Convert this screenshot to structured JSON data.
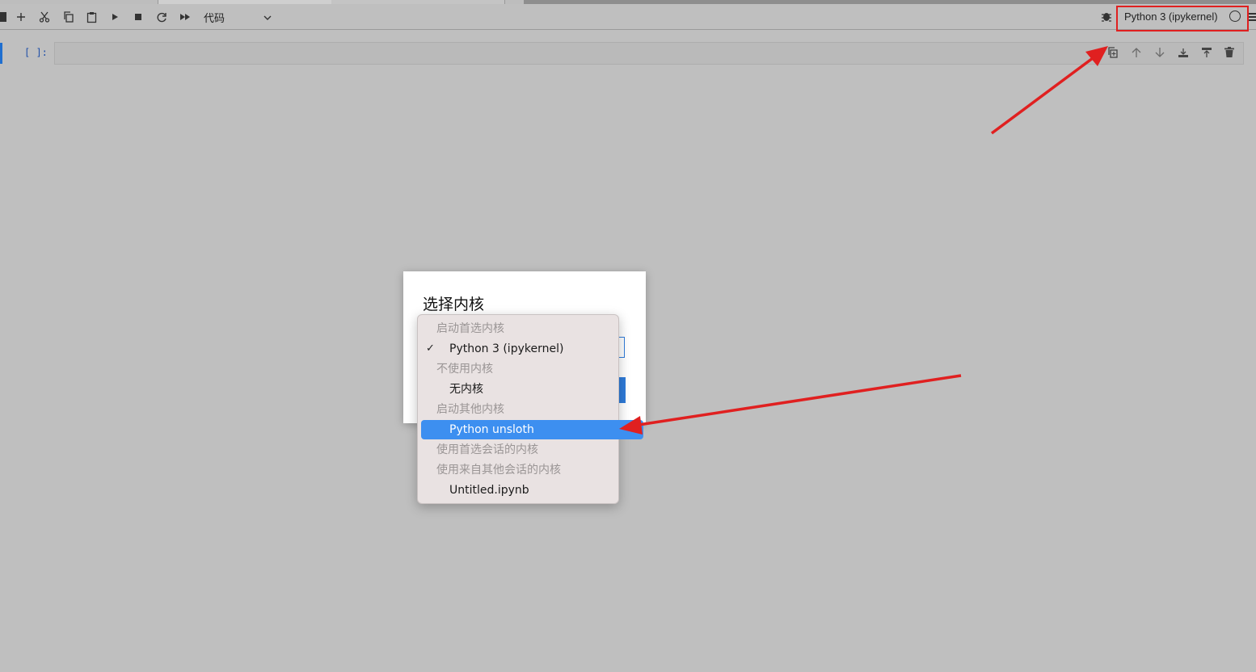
{
  "toolbar": {
    "cell_type": "代码",
    "kernel_name": "Python 3 (ipykernel)"
  },
  "cell": {
    "prompt": "[ ]:"
  },
  "dialog": {
    "title": "选择内核"
  },
  "dropdown": {
    "rows": [
      {
        "kind": "header",
        "label": "启动首选内核"
      },
      {
        "kind": "item",
        "label": "Python 3 (ipykernel)",
        "checked": true
      },
      {
        "kind": "header",
        "label": "不使用内核"
      },
      {
        "kind": "item",
        "label": "无内核"
      },
      {
        "kind": "header",
        "label": "启动其他内核"
      },
      {
        "kind": "item",
        "label": "Python unsloth",
        "highlighted": true
      },
      {
        "kind": "header",
        "label": "使用首选会话的内核"
      },
      {
        "kind": "header",
        "label": "使用来自其他会话的内核"
      },
      {
        "kind": "item",
        "label": "Untitled.ipynb"
      }
    ]
  },
  "colors": {
    "accent": "#3d8ff0",
    "annotation_red": "#e02020",
    "background": "#bfbfbf"
  }
}
